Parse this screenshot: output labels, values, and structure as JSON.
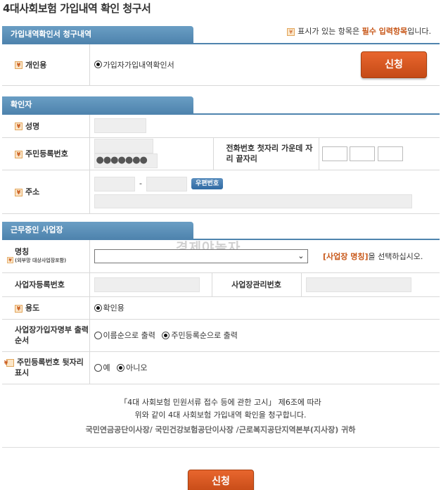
{
  "page": {
    "title": "4대사회보험 가입내역 확인 청구서"
  },
  "legend": {
    "prefix": "표시가 있는 항목은",
    "highlight": "필수 입력항목",
    "suffix": "입니다."
  },
  "req_mark_glyph": "¥",
  "section1": {
    "tab": "가입내역확인서 청구내역",
    "label": "개인용",
    "option": "가입자가입내역확인서",
    "apply_button": "신청"
  },
  "section2": {
    "tab": "확인자",
    "name_label": "성명",
    "rrn_label": "주민등록번호",
    "rrn_masked": "●●●●●●●",
    "phone_label": "전화번호 첫자리 가운데 자리 끝자리",
    "address_label": "주소",
    "zip_dash": "-",
    "zip_button": "우편번호"
  },
  "section3": {
    "tab": "근무중인 사업장",
    "name_label": "명칭",
    "name_sublabel": "(외부망 대상사업장포함)",
    "hint_highlight": "[사업장 명칭]",
    "hint_suffix": "을 선택하십시오.",
    "biz_reg_label": "사업자등록번호",
    "biz_mgmt_label": "사업장관리번호",
    "purpose_label": "용도",
    "purpose_option": "확인용",
    "order_label": "사업장가입자명부 출력순서",
    "order_options": [
      "이름순으로 출력",
      "주민등록순으로 출력"
    ],
    "rrn_show_label": "주민등록번호 뒷자리 표시",
    "rrn_show_options": [
      "예",
      "아니오"
    ]
  },
  "notice": {
    "line1": "「4대 사회보험 민원서류 접수 등에 관한 고시」 제6조에 따라",
    "line2": "위와 같이 4대 사회보험 가입내역 확인을 청구합니다.",
    "offices": "국민연금공단이사장/ 국민건강보험공단이사장 /근로복지공단지역본부(지사장) 귀하"
  },
  "watermark": "경제야놀자",
  "bottom_button": "신청",
  "colors": {
    "accent": "#c8581a",
    "tab": "#4f84ae",
    "button": "#d5551f"
  }
}
